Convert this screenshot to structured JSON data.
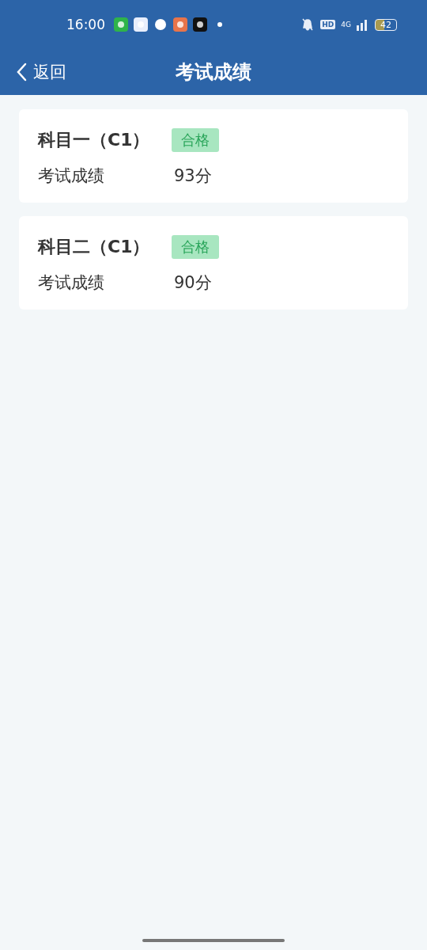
{
  "status_bar": {
    "time": "16:00",
    "hd": "HD",
    "network": "4G",
    "battery": "42"
  },
  "nav": {
    "back": "返回",
    "title": "考试成绩"
  },
  "results": [
    {
      "subject": "科目一（C1）",
      "badge": {
        "kind": "pass",
        "label": "合格"
      },
      "label": "考试成绩",
      "score": "93分"
    },
    {
      "subject": "科目二（C1）",
      "badge": {
        "kind": "pass",
        "label": "合格"
      },
      "label": "考试成绩",
      "score": "90分"
    }
  ]
}
